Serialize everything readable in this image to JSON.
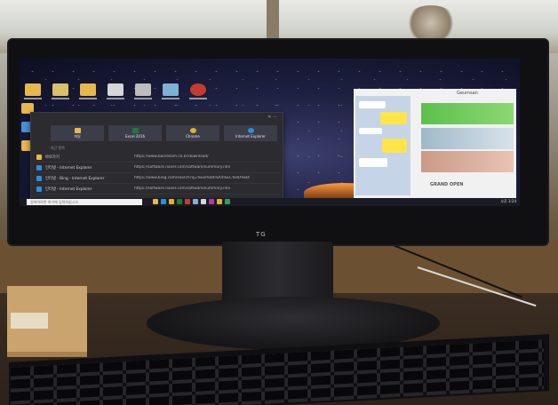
{
  "monitor": {
    "brand": "TG"
  },
  "video_call": {
    "participant_name": "Geumsan",
    "banner_text": "GRAND OPEN"
  },
  "start_menu": {
    "close_glyph": "✕ ⋯",
    "pinned": [
      {
        "label": "파일",
        "icon": "folder-icon",
        "color": "#e7b84a"
      },
      {
        "label": "Excel 2016",
        "icon": "excel-icon",
        "color": "#1f7a3e"
      },
      {
        "label": "Chrome",
        "icon": "chrome-icon",
        "color": "#e0b12a"
      },
      {
        "label": "Internet Explorer",
        "icon": "ie-icon",
        "color": "#2b8fd8"
      }
    ],
    "section_label": "최근 항목",
    "recent": [
      {
        "icon": "folder-icon",
        "color": "#e7b84a",
        "title": "바로가기",
        "url": "https://www.bandisam.co.kr/download/"
      },
      {
        "icon": "ie-icon",
        "color": "#2b8fd8",
        "title": "인터넷 - Internet Explorer",
        "url": "https://software.naver.com/software/summary.nhn"
      },
      {
        "icon": "ie-icon",
        "color": "#2b8fd8",
        "title": "인터넷 - Bing - Internet Explorer",
        "url": "https://www.bing.com/search?q=%EB%84%A4%EC%9D%B4"
      },
      {
        "icon": "ie-icon",
        "color": "#2b8fd8",
        "title": "인터넷 - Internet Explorer",
        "url": "https://software.naver.com/software/summary.nhn"
      }
    ]
  },
  "taskbar": {
    "search_placeholder": "검색하려면 여기에 입력하십시오.",
    "clock": "오후 3:24"
  }
}
